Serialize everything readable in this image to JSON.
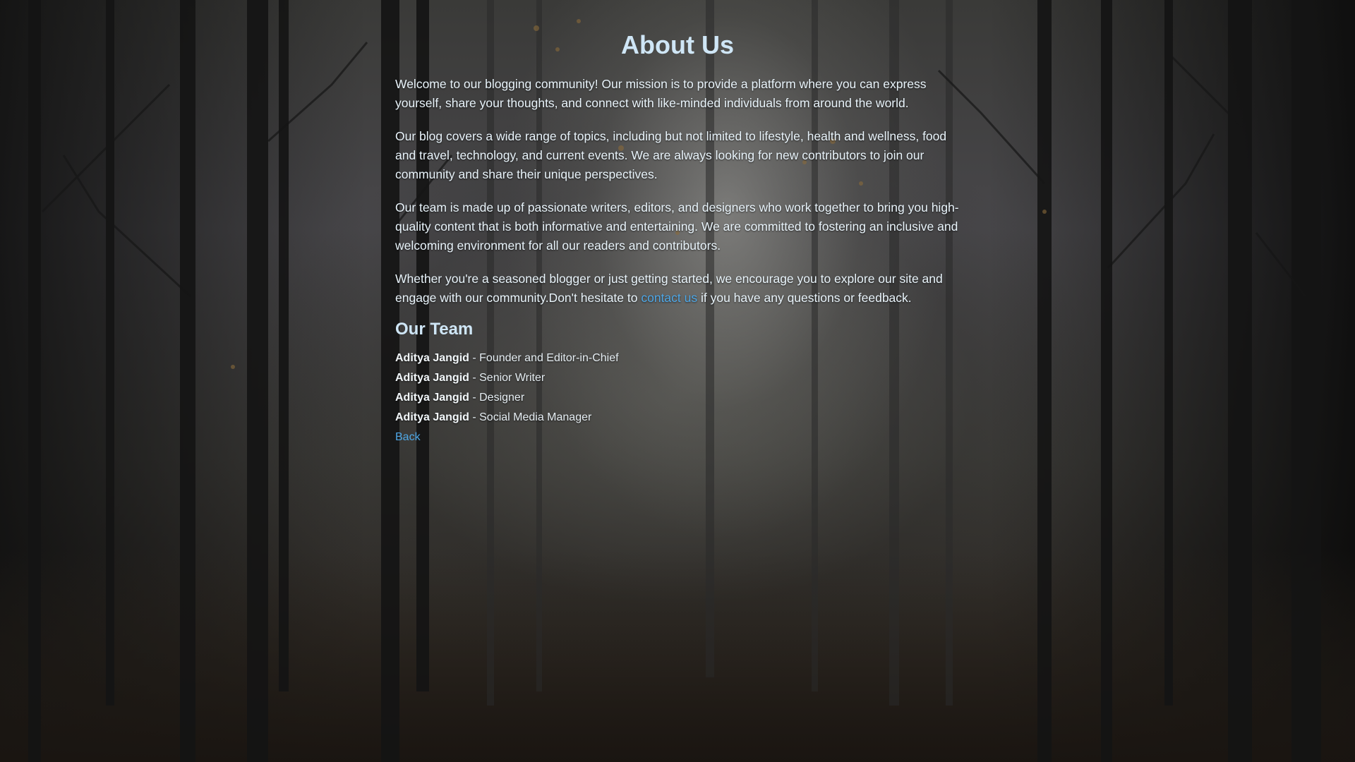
{
  "page": {
    "title": "About Us"
  },
  "paragraphs": [
    "Welcome to our blogging community! Our mission is to provide a platform where you can express yourself, share your thoughts, and connect with like-minded individuals from around the world.",
    "Our blog covers a wide range of topics, including but not limited to lifestyle, health and wellness, food and travel, technology, and current events. We are always looking for new contributors to join our community and share their unique perspectives.",
    "Our team is made up of passionate writers, editors, and designers who work together to bring you high-quality content that is both informative and entertaining. We are committed to fostering an inclusive and welcoming environment for all our readers and contributors."
  ],
  "closing": {
    "before_link": "Whether you're a seasoned blogger or just getting started, we encourage you to explore our site and engage with our community.Don't hesitate to ",
    "link_text": "contact us",
    "after_link": " if you have any questions or feedback."
  },
  "team": {
    "heading": "Our Team",
    "members": [
      {
        "name": "Aditya Jangid",
        "role": " - Founder and Editor-in-Chief"
      },
      {
        "name": "Aditya Jangid",
        "role": " - Senior Writer"
      },
      {
        "name": "Aditya Jangid",
        "role": " - Designer"
      },
      {
        "name": "Aditya Jangid",
        "role": " - Social Media Manager"
      }
    ]
  },
  "back_link": "Back",
  "colors": {
    "heading": "#cfe6f6",
    "link": "#4ea7e6",
    "text": "#e9f4fb"
  }
}
